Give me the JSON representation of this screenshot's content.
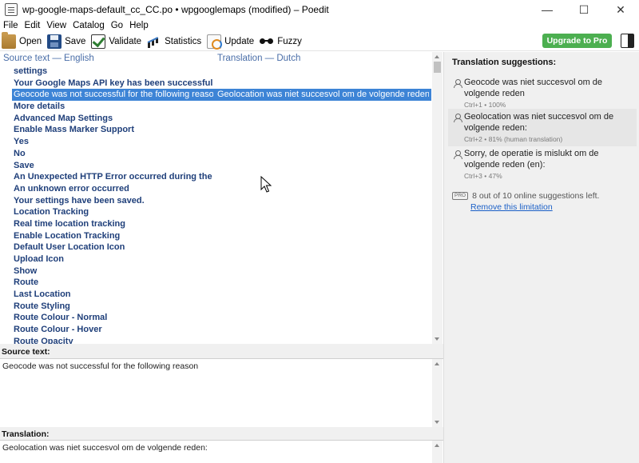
{
  "window": {
    "title": "wp-google-maps-default_cc_CC.po • wpgooglemaps (modified) – Poedit",
    "minimize_glyph": "—",
    "maximize_glyph": "☐",
    "close_glyph": "✕"
  },
  "menu": [
    "File",
    "Edit",
    "View",
    "Catalog",
    "Go",
    "Help"
  ],
  "toolbar": {
    "open": "Open",
    "save": "Save",
    "validate": "Validate",
    "statistics": "Statistics",
    "update": "Update",
    "fuzzy": "Fuzzy",
    "upgrade": "Upgrade to Pro"
  },
  "list": {
    "header_source": "Source text — English",
    "header_translation": "Translation — Dutch",
    "rows": [
      {
        "source": "settings",
        "translation": ""
      },
      {
        "source": "Your Google Maps API key has been successfully sa...",
        "translation": ""
      },
      {
        "source": "Geocode was not successful for the following reason",
        "translation": "Geolocation was niet succesvol om de volgende reden:",
        "selected": true
      },
      {
        "source": "More details",
        "translation": ""
      },
      {
        "source": "Advanced Map Settings",
        "translation": ""
      },
      {
        "source": "Enable Mass Marker Support",
        "translation": ""
      },
      {
        "source": "Yes",
        "translation": ""
      },
      {
        "source": "No",
        "translation": ""
      },
      {
        "source": "Save",
        "translation": ""
      },
      {
        "source": "An Unexpected HTTP Error occurred during the API...",
        "translation": ""
      },
      {
        "source": "An unknown error occurred",
        "translation": ""
      },
      {
        "source": "Your settings have been saved.",
        "translation": ""
      },
      {
        "source": "Location Tracking",
        "translation": ""
      },
      {
        "source": "Real time location tracking",
        "translation": ""
      },
      {
        "source": "Enable Location Tracking",
        "translation": ""
      },
      {
        "source": "Default User Location Icon",
        "translation": ""
      },
      {
        "source": "Upload Icon",
        "translation": ""
      },
      {
        "source": "Show",
        "translation": ""
      },
      {
        "source": "Route",
        "translation": ""
      },
      {
        "source": "Last Location",
        "translation": ""
      },
      {
        "source": "Route Styling",
        "translation": ""
      },
      {
        "source": "Route Colour - Normal",
        "translation": ""
      },
      {
        "source": "Route Colour - Hover",
        "translation": ""
      },
      {
        "source": "Route Opacity",
        "translation": ""
      }
    ]
  },
  "suggestions": {
    "title": "Translation suggestions:",
    "items": [
      {
        "text": "Geocode was niet succesvol om de volgende reden",
        "shortcut": "Ctrl+1 • 100%",
        "note": ""
      },
      {
        "text": "Geolocation was niet succesvol om de volgende reden:",
        "shortcut": "Ctrl+2 • 81%",
        "note": "(human translation)"
      },
      {
        "text": "Sorry, de operatie is mislukt om de volgende reden (en):",
        "shortcut": "Ctrl+3 • 47%",
        "note": ""
      }
    ],
    "pro_badge": "PRO",
    "remaining": "8 out of 10 online suggestions left.",
    "remove_link": "Remove this limitation"
  },
  "source_pane": {
    "label": "Source text:",
    "text": "Geocode was not successful for the following reason"
  },
  "translation_pane": {
    "label": "Translation:",
    "text": "Geolocation was niet succesvol om de volgende reden:"
  }
}
